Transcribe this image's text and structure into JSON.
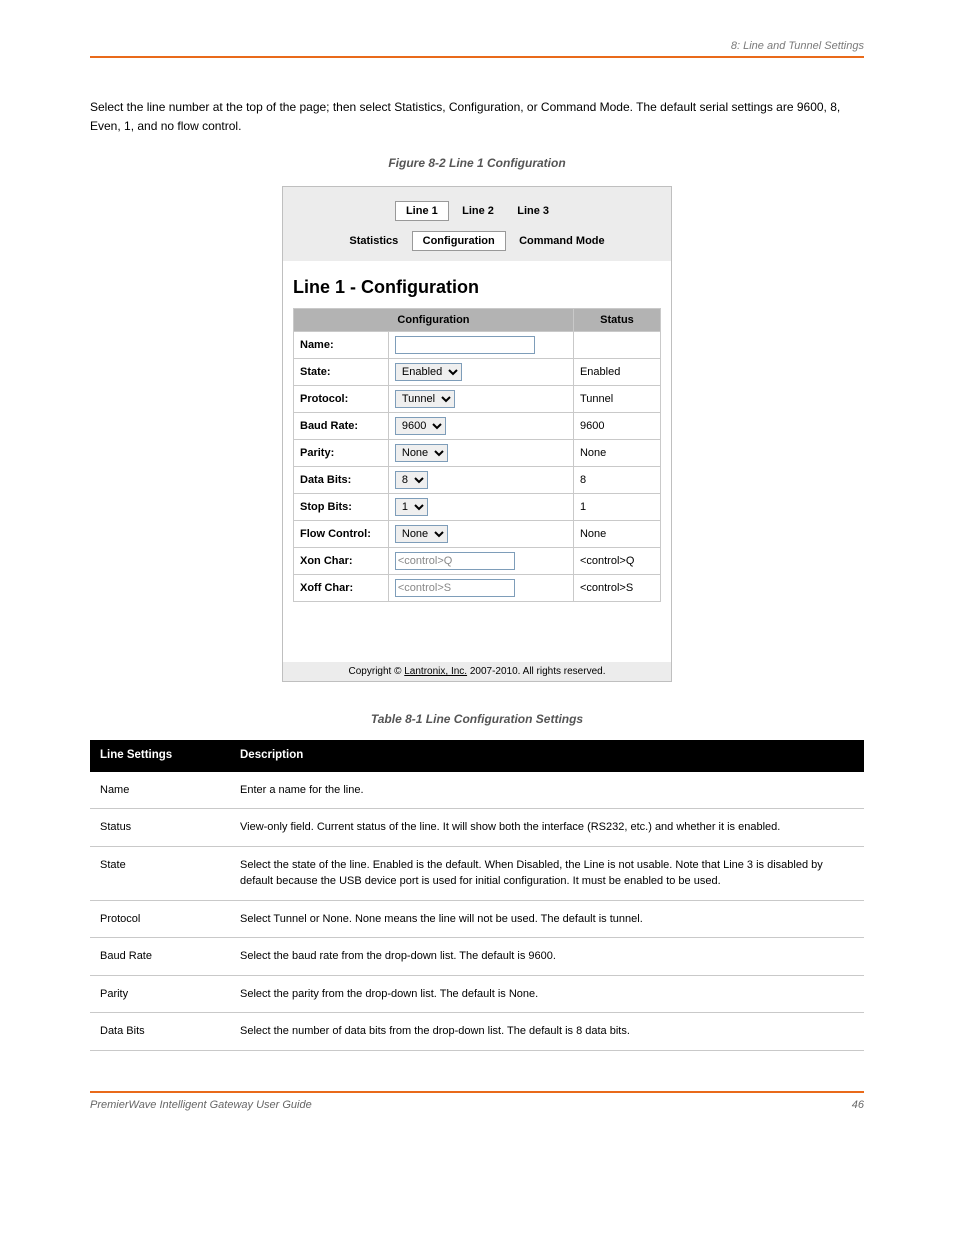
{
  "chapter": "8: Line and Tunnel Settings",
  "intro": "Select the line number at the top of the page; then select Statistics, Configuration, or Command Mode. The default serial settings are 9600, 8, Even, 1, and no flow control.",
  "figure_caption": "Figure 8-2 Line 1 Configuration",
  "table_caption": "Table 8-1 Line Configuration Settings",
  "shot": {
    "tabs": [
      "Line 1",
      "Line 2",
      "Line 3"
    ],
    "subtabs": [
      "Statistics",
      "Configuration",
      "Command Mode"
    ],
    "heading": "Line 1 - Configuration",
    "col_config": "Configuration",
    "col_status": "Status",
    "rows": [
      {
        "label": "Name:",
        "type": "text",
        "value": "",
        "status": ""
      },
      {
        "label": "State:",
        "type": "select",
        "value": "Enabled",
        "status": "Enabled"
      },
      {
        "label": "Protocol:",
        "type": "select",
        "value": "Tunnel",
        "status": "Tunnel"
      },
      {
        "label": "Baud Rate:",
        "type": "select",
        "value": "9600",
        "status": "9600"
      },
      {
        "label": "Parity:",
        "type": "select",
        "value": "None",
        "status": "None"
      },
      {
        "label": "Data Bits:",
        "type": "select",
        "value": "8",
        "status": "8"
      },
      {
        "label": "Stop Bits:",
        "type": "select",
        "value": "1",
        "status": "1"
      },
      {
        "label": "Flow Control:",
        "type": "select",
        "value": "None",
        "status": "None"
      },
      {
        "label": "Xon Char:",
        "type": "ro",
        "value": "<control>Q",
        "status": "<control>Q"
      },
      {
        "label": "Xoff Char:",
        "type": "ro",
        "value": "<control>S",
        "status": "<control>S"
      }
    ],
    "footer_prefix": "Copyright © ",
    "footer_link": "Lantronix, Inc.",
    "footer_suffix": " 2007-2010. All rights reserved."
  },
  "settings_header": {
    "col1": "Line Settings",
    "col2": "Description"
  },
  "settings": [
    {
      "k": "Name",
      "v": "Enter a name for the line."
    },
    {
      "k": "Status",
      "v": "View-only field. Current status of the line. It will show both the interface (RS232, etc.) and whether it is enabled."
    },
    {
      "k": "State",
      "v": "Select the state of the line. Enabled is the default. When Disabled, the Line is not usable. Note that Line 3 is disabled by default because the USB device port is used for initial configuration. It must be enabled to be used."
    },
    {
      "k": "Protocol",
      "v": "Select Tunnel or None. None means the line will not be used. The default is tunnel."
    },
    {
      "k": "Baud Rate",
      "v": "Select the baud rate from the drop-down list. The default is 9600."
    },
    {
      "k": "Parity",
      "v": "Select the parity from the drop-down list. The default is None."
    },
    {
      "k": "Data Bits",
      "v": "Select the number of data bits from the drop-down list. The default is 8 data bits."
    }
  ],
  "footer_left": "PremierWave Intelligent Gateway User Guide",
  "footer_right": "46"
}
